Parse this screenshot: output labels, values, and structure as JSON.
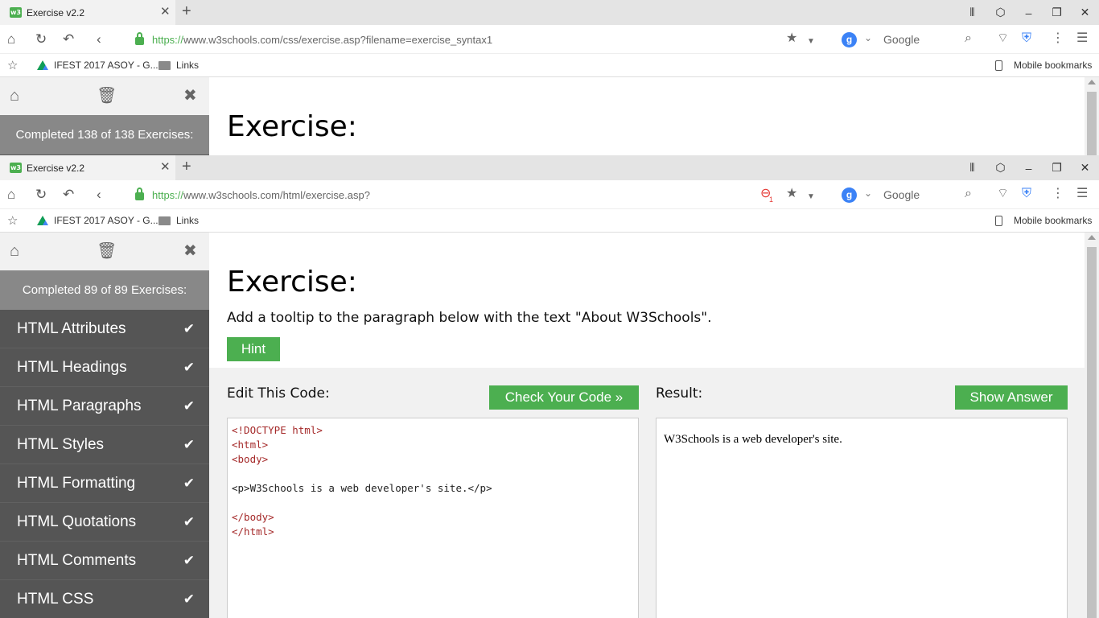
{
  "window1": {
    "tab_title": "Exercise v2.2",
    "url_scheme": "https://",
    "url_rest": "www.w3schools.com/css/exercise.asp?filename=exercise_syntax1",
    "search_engine": "Google",
    "bookmarks": {
      "item1": "IFEST 2017 ASOY - G...",
      "item2": "Links",
      "mobile": "Mobile bookmarks"
    },
    "sidebar_progress": "Completed 138 of 138 Exercises:",
    "exercise_title": "Exercise:"
  },
  "window2": {
    "tab_title": "Exercise v2.2",
    "url_scheme": "https://",
    "url_rest": "www.w3schools.com/html/exercise.asp?",
    "blocked_count": "1",
    "search_engine": "Google",
    "bookmarks": {
      "item1": "IFEST 2017 ASOY - G...",
      "item2": "Links",
      "mobile": "Mobile bookmarks"
    },
    "sidebar_progress": "Completed 89 of 89 Exercises:",
    "sidebar_items": [
      {
        "label": "HTML Attributes",
        "active": true
      },
      {
        "label": "HTML Headings"
      },
      {
        "label": "HTML Paragraphs"
      },
      {
        "label": "HTML Styles"
      },
      {
        "label": "HTML Formatting"
      },
      {
        "label": "HTML Quotations"
      },
      {
        "label": "HTML Comments"
      },
      {
        "label": "HTML CSS"
      }
    ],
    "exercise_title": "Exercise:",
    "exercise_text": "Add a tooltip to the paragraph below with the text \"About W3Schools\".",
    "hint_label": "Hint",
    "edit_label": "Edit This Code:",
    "check_label": "Check Your Code »",
    "result_label": "Result:",
    "show_answer_label": "Show Answer",
    "code_lines": [
      "<!DOCTYPE html>",
      "<html>",
      "<body>",
      "",
      "<p>W3Schools is a web developer's site.</p>",
      "",
      "</body>",
      "</html>"
    ],
    "result_text": "W3Schools is a web developer's site."
  },
  "icons": {
    "home": "home-icon",
    "reload": "reload-icon",
    "undo": "undo-icon",
    "back": "back-icon",
    "star": "star-icon",
    "search": "search-icon",
    "wifi": "wifi-icon",
    "shield": "shield-icon",
    "more": "more-icon",
    "menu": "menu-icon",
    "trash": "trash-icon",
    "close": "close-icon",
    "check": "check-icon"
  },
  "colors": {
    "accent_green": "#4caf50",
    "sidebar_dark": "#555555",
    "sidebar_progress": "#888888"
  }
}
